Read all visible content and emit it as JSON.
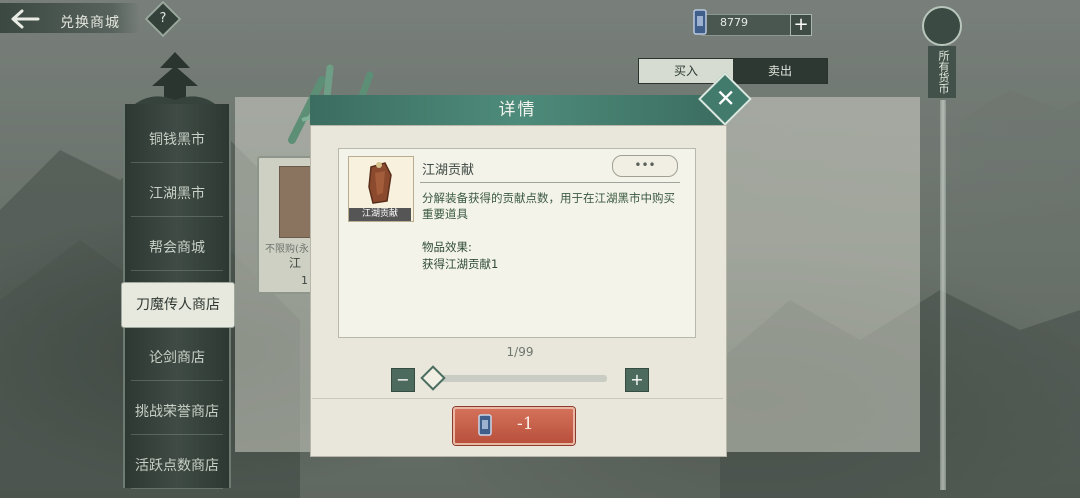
{
  "header": {
    "shop_title": "兑换商城",
    "help_label": "?",
    "currency_value": "8779",
    "add_label": "+",
    "all_currency_label": "所有货币"
  },
  "trade_tabs": [
    {
      "label": "买入",
      "active": true
    },
    {
      "label": "卖出",
      "active": false
    }
  ],
  "sidebar": {
    "items": [
      {
        "label": "铜钱黑市"
      },
      {
        "label": "江湖黑市"
      },
      {
        "label": "帮会商城"
      },
      {
        "label": "刀魔传人商店",
        "active": true
      },
      {
        "label": "论剑商店"
      },
      {
        "label": "挑战荣誉商店"
      },
      {
        "label": "活跃点数商店"
      }
    ]
  },
  "shop_card": {
    "small_text": "不限购(永",
    "name": "江",
    "count": "1"
  },
  "modal": {
    "title": "详情",
    "close_label": "✕",
    "item_name": "江湖贡献",
    "item_icon_caption": "江湖贡献",
    "more_label": "•••",
    "description": "分解装备获得的贡献点数，用于在江湖黑市中购买重要道具",
    "effect_label": "物品效果:",
    "effect_text": "获得江湖贡献1",
    "quantity_text": "1/99",
    "quantity": {
      "current": 1,
      "max": 99
    },
    "minus_label": "−",
    "plus_label": "+",
    "confirm_label": "-1"
  },
  "colors": {
    "accent": "#4e8b7a",
    "confirm": "#c0583f",
    "sidebar": "#2d3832"
  }
}
